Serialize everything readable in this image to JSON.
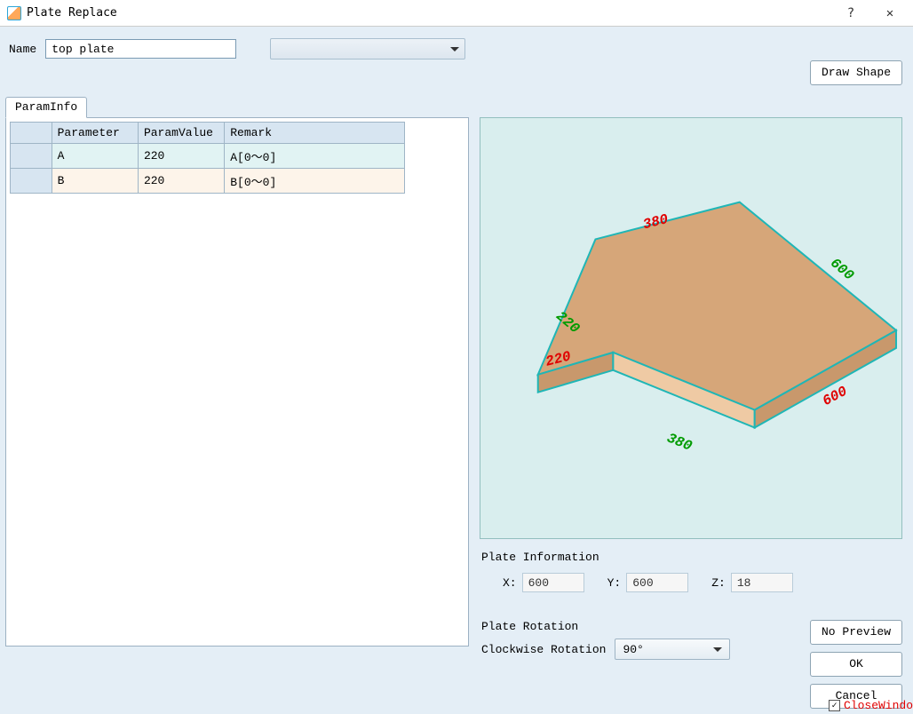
{
  "window": {
    "title": "Plate Replace",
    "help_icon": "?",
    "close_icon": "✕"
  },
  "toolbar": {
    "name_label": "Name",
    "name_value": "top plate",
    "draw_shape_label": "Draw Shape"
  },
  "tabs": {
    "param_info_label": "ParamInfo"
  },
  "param_table": {
    "headers": {
      "parameter": "Parameter",
      "param_value": "ParamValue",
      "remark": "Remark"
    },
    "rows": [
      {
        "parameter": "A",
        "value": "220",
        "remark": "A[0～0]"
      },
      {
        "parameter": "B",
        "value": "220",
        "remark": "B[0～0]"
      }
    ]
  },
  "preview_dims": {
    "d1": "380",
    "d2": "600",
    "d3": "220",
    "d4": "220",
    "d5": "600",
    "d6": "380"
  },
  "plate_info": {
    "title": "Plate Information",
    "x_label": "X:",
    "x_value": "600",
    "y_label": "Y:",
    "y_value": "600",
    "z_label": "Z:",
    "z_value": "18"
  },
  "rotation": {
    "title": "Plate Rotation",
    "label": "Clockwise Rotation",
    "value": "90°"
  },
  "buttons": {
    "no_preview": "No Preview",
    "ok": "OK",
    "cancel": "Cancel"
  },
  "close_window": {
    "checked": true,
    "label": "CloseWindo"
  }
}
